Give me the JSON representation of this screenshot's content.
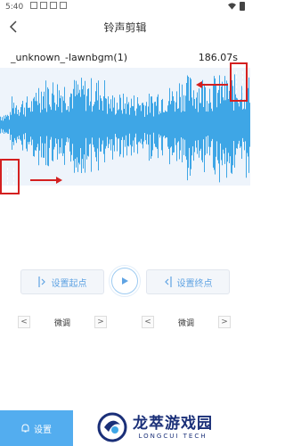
{
  "status_bar": {
    "time": "5:40"
  },
  "header": {
    "title": "铃声剪辑"
  },
  "file": {
    "name": "_unknown_-lawnbgm(1)",
    "duration": "186.07s"
  },
  "controls": {
    "set_start_label": "设置起点",
    "set_end_label": "设置终点"
  },
  "fine_tune": {
    "left": {
      "prev": "<",
      "label": "微调",
      "next": ">"
    },
    "right": {
      "prev": "<",
      "label": "微调",
      "next": ">"
    }
  },
  "bottom": {
    "settings_label": "设置"
  },
  "watermark": {
    "main": "龙萃游戏园",
    "sub": "LONGCUI TECH"
  },
  "colors": {
    "accent": "#53adef",
    "waveform": "#3ea6e6",
    "marker": "#d42020",
    "brand": "#1a2f78"
  }
}
